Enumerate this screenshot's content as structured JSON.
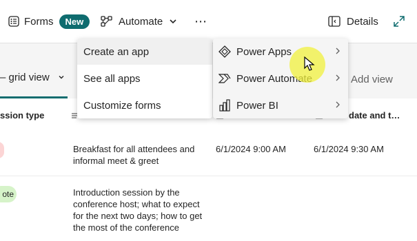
{
  "toolbar": {
    "forms_label": "Forms",
    "new_badge": "New",
    "automate_label": "Automate",
    "more_label": "⋯",
    "details_label": "Details"
  },
  "view": {
    "current_view": "– grid view",
    "add_view": "Add view"
  },
  "table": {
    "headers": [
      "ssion type",
      "date and t…"
    ],
    "rows": [
      {
        "description": "Breakfast for all attendees and informal meet & greet",
        "start": "6/1/2024 9:00 AM",
        "end": "6/1/2024 9:30 AM",
        "pill": ""
      },
      {
        "description": "Introduction session by the conference host; what to expect for the next two days; how to get the most of the conference",
        "start": "",
        "end": "",
        "pill": "ote"
      }
    ]
  },
  "automate_menu": {
    "items": [
      "Create an app",
      "See all apps",
      "Customize forms"
    ]
  },
  "create_app_submenu": {
    "items": [
      "Power Apps",
      "Power Automate",
      "Power BI"
    ]
  },
  "colors": {
    "accent": "#0f6c6f",
    "pill_red": "#fcd5d5",
    "pill_green": "#d6f3c9"
  }
}
